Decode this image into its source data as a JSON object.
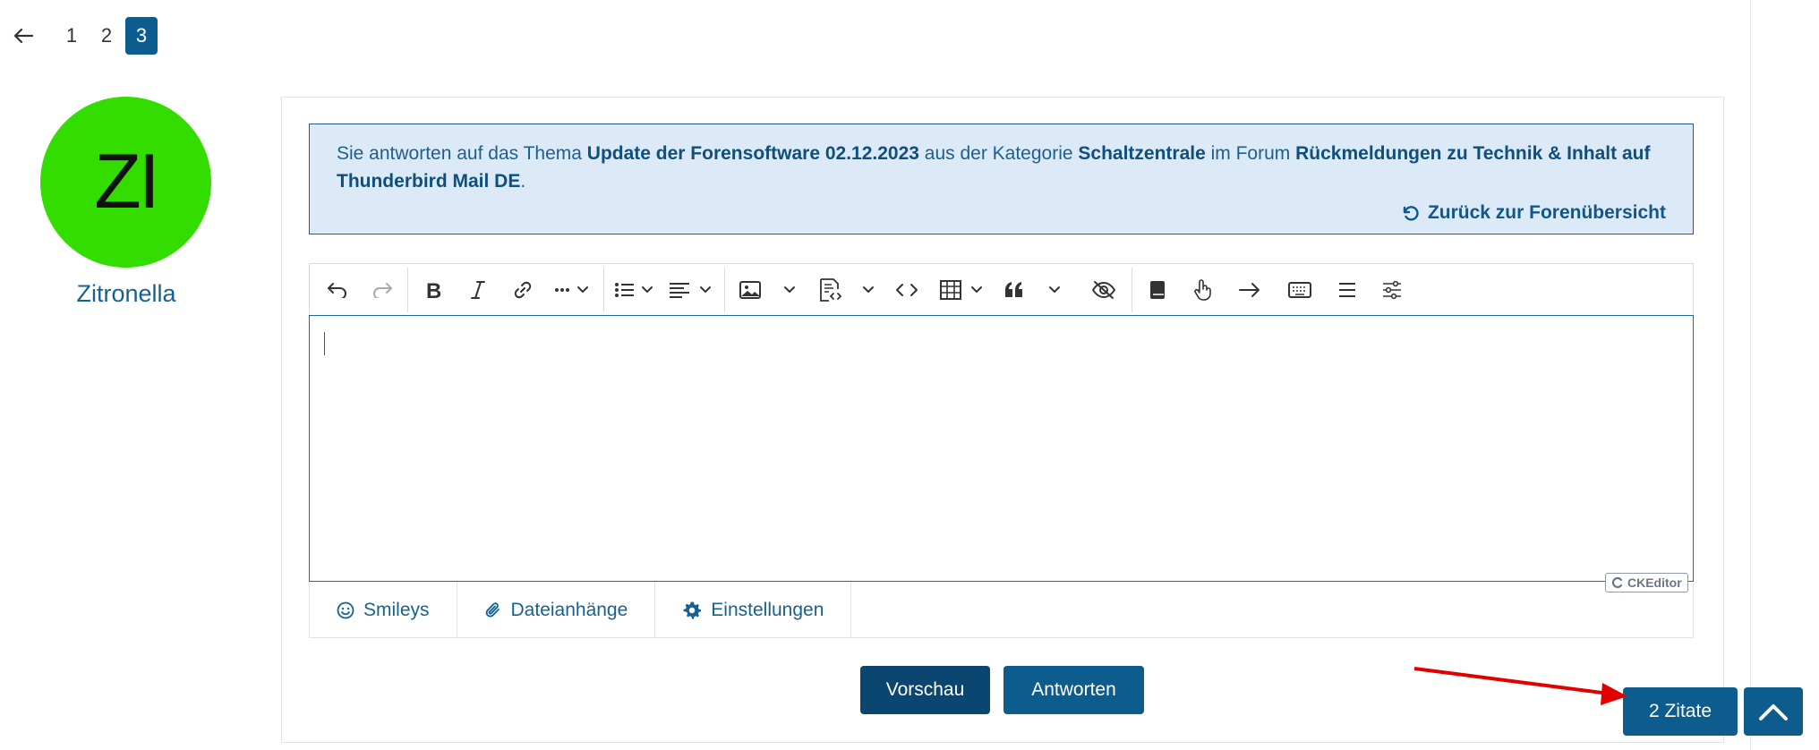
{
  "pagination": {
    "back_icon": "arrow-left-icon",
    "pages": [
      "1",
      "2",
      "3"
    ],
    "current": "3"
  },
  "user": {
    "avatar_initials": "ZI",
    "avatar_color": "#33dd00",
    "name": "Zitronella"
  },
  "reply_info": {
    "t1": "Sie antworten auf das Thema ",
    "topic": "Update der Forensoftware 02.12.2023",
    "t2": " aus der Kategorie ",
    "category": "Schaltzentrale",
    "t3": " im Forum ",
    "forum": "Rückmeldungen zu Technik & Inhalt auf Thunderbird Mail DE",
    "t4": ".",
    "back_link": "Zurück zur Forenübersicht"
  },
  "toolbar": {
    "icons": [
      "undo-icon",
      "redo-icon",
      "bold-icon",
      "italic-icon",
      "link-icon",
      "more-icon",
      "bulleted-list-icon",
      "align-icon",
      "image-icon",
      "code-block-icon",
      "inline-code-icon",
      "table-icon",
      "quote-icon",
      "spoiler-icon",
      "book-icon",
      "pointer-icon",
      "arrow-right-icon",
      "keyboard-icon",
      "menu-icon",
      "sliders-icon"
    ]
  },
  "editor": {
    "content": "",
    "powered_by": "CKEditor"
  },
  "tabs": {
    "smileys": "Smileys",
    "attachments": "Dateianhänge",
    "settings": "Einstellungen"
  },
  "buttons": {
    "preview": "Vorschau",
    "reply": "Antworten",
    "quotes": "2 Zitate"
  },
  "colors": {
    "primary": "#0d5c8e",
    "primary_dark": "#0b4670",
    "info_bg": "#dceaf7",
    "annotation_arrow": "#e00000"
  }
}
